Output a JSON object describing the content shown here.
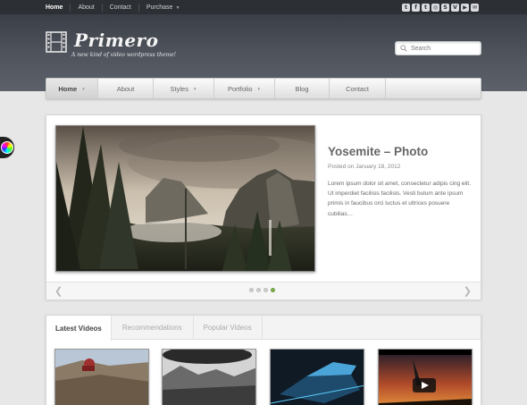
{
  "topbar": {
    "links": [
      "Home",
      "About",
      "Contact",
      "Purchase"
    ],
    "socials": [
      "twitter-icon",
      "facebook-icon",
      "tumblr-icon",
      "dribbble-icon",
      "skype-icon",
      "vimeo-icon",
      "youtube-icon",
      "email-icon"
    ]
  },
  "header": {
    "logo": "Primero",
    "tagline": "A new kind of video wordpress theme!",
    "search_placeholder": "Search"
  },
  "nav": {
    "items": [
      "Home",
      "About",
      "Styles",
      "Portfolio",
      "Blog",
      "Contact"
    ]
  },
  "slider": {
    "title": "Yosemite – Photo",
    "date": "Posted on January 18, 2012",
    "excerpt": "Lorem ipsum dolor sit amet, consectetur adipis cing elit. Ut imperdiet facilisis facilisis. Vesti bulum ante ipsum primis in faucibus orci luctus et ultrices posuere cubilias…",
    "active_slide_index": 4,
    "slide_count": 4
  },
  "videos": {
    "tabs": [
      "Latest Videos",
      "Recommendations",
      "Popular Videos"
    ]
  },
  "colors": {
    "accent_green": "#7db54a",
    "topbar": "#2c2f33",
    "header": "#4e535c"
  }
}
